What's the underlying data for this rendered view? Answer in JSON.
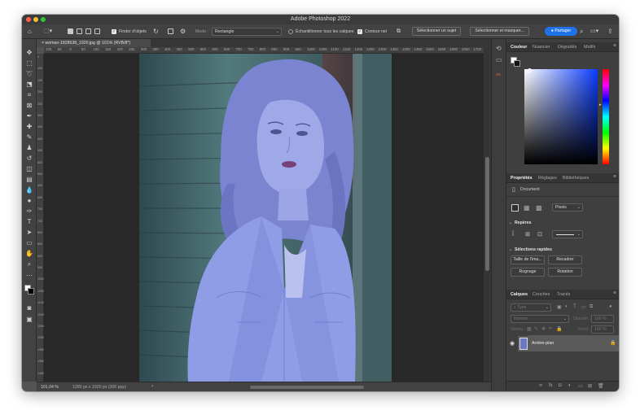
{
  "window": {
    "title": "Adobe Photoshop 2022"
  },
  "traffic_lights": {
    "close": "#ff5f57",
    "minimize": "#febc2e",
    "zoom": "#28c840"
  },
  "options_bar": {
    "finder_label": "Finder d'objets",
    "mode_label": "Mode :",
    "mode_value": "Rectangle",
    "sample_all_label": "Échantillonner tous les calques",
    "hard_edge_label": "Contour net",
    "select_subject_label": "Sélectionner un sujet",
    "select_mask_label": "Sélectionner et masquer...",
    "share_label": "Partager",
    "accent_color": "#1f73e8"
  },
  "document": {
    "tab_title": "woman-1828538_1920.jpg @ 101% (RVB/8*)",
    "zoom": "101,04 %",
    "info": "1280 px x 1920 px (300 ppp)"
  },
  "ruler_h_ticks": [
    "100",
    "50",
    "0",
    "50",
    "100",
    "150",
    "200",
    "250",
    "300",
    "350",
    "400",
    "450",
    "500",
    "550",
    "600",
    "650",
    "700",
    "750",
    "800",
    "850",
    "900",
    "950",
    "1000",
    "1050",
    "1100",
    "1150",
    "1200",
    "1250",
    "1300",
    "1350",
    "1400",
    "1450",
    "1500",
    "1550",
    "1600",
    "1650",
    "1700"
  ],
  "ruler_v_ticks": [
    "0",
    "100",
    "150",
    "200",
    "250",
    "300",
    "350",
    "400",
    "450",
    "500",
    "550",
    "600",
    "650",
    "700",
    "750",
    "800",
    "850",
    "900",
    "950",
    "1000",
    "1050",
    "1100",
    "1150",
    "1200",
    "1250",
    "1300",
    "1350",
    "1400"
  ],
  "color_panel": {
    "tabs": [
      "Couleur",
      "Nuancier",
      "Dégradés",
      "Motifs"
    ],
    "active_tab": "Couleur"
  },
  "properties_panel": {
    "tabs": [
      "Propriétés",
      "Réglages",
      "Bibliothèques"
    ],
    "doc_label": "Document",
    "units_value": "Pixels",
    "guides_title": "Repères",
    "quick_actions_title": "Sélections rapides",
    "quick_actions": [
      "Taille de l'ima...",
      "Recadrer",
      "Rognage",
      "Rotation"
    ]
  },
  "layers_panel": {
    "tabs": [
      "Calques",
      "Couches",
      "Tracés"
    ],
    "filter_placeholder": "Type",
    "blend_mode": "Normal",
    "opacity_label": "Opacité :",
    "opacity_value": "100 %",
    "lock_label": "Verrou :",
    "fill_label": "Fond :",
    "fill_value": "100 %",
    "layers": [
      {
        "name": "Arrière-plan",
        "visible": true,
        "locked": true
      }
    ]
  }
}
